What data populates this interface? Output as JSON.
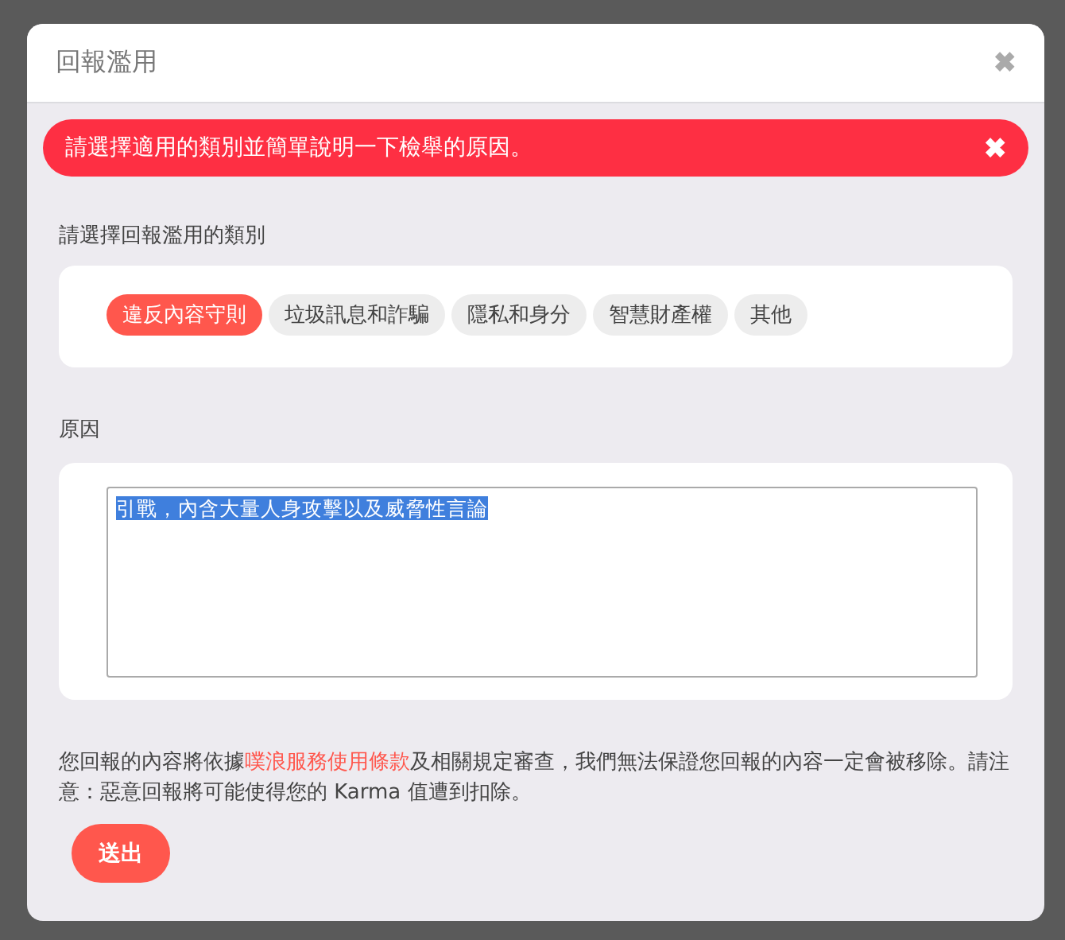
{
  "dialog": {
    "title": "回報濫用",
    "close": "✖"
  },
  "alert": {
    "message": "請選擇適用的類別並簡單說明一下檢舉的原因。",
    "close": "✖"
  },
  "category_label": "請選擇回報濫用的類別",
  "categories": [
    {
      "label": "違反內容守則",
      "selected": true
    },
    {
      "label": "垃圾訊息和詐騙",
      "selected": false
    },
    {
      "label": "隱私和身分",
      "selected": false
    },
    {
      "label": "智慧財產權",
      "selected": false
    },
    {
      "label": "其他",
      "selected": false
    }
  ],
  "reason_label": "原因",
  "reason": {
    "value": "引戰，內含大量人身攻擊以及威脅性言論",
    "text_selected": true
  },
  "notice": {
    "before": "您回報的內容將依據",
    "link": "噗浪服務使用條款",
    "after": "及相關規定審查，我們無法保證您回報的內容一定會被移除。請注意：惡意回報將可能使得您的 Karma 值遭到扣除。"
  },
  "submit": "送出"
}
